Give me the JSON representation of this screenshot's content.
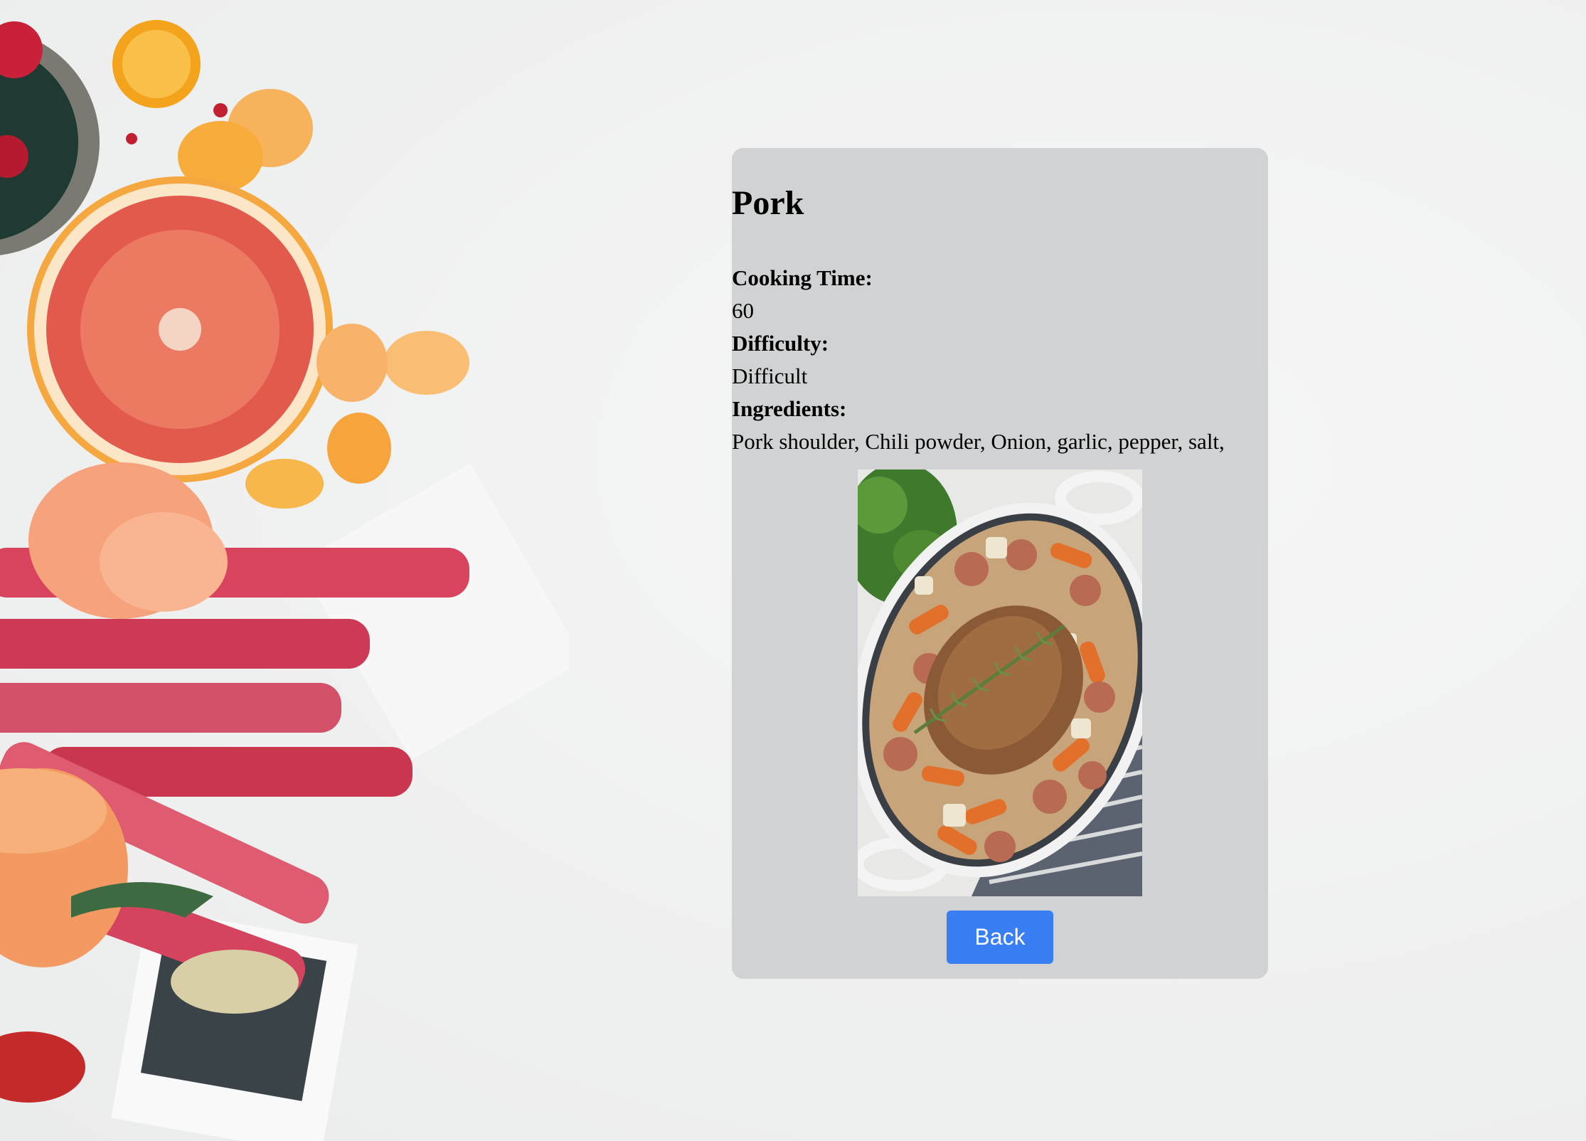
{
  "recipe": {
    "title": "Pork",
    "cooking_time_label": "Cooking Time:",
    "cooking_time_value": "60",
    "difficulty_label": "Difficulty:",
    "difficulty_value": "Difficult",
    "ingredients_label": "Ingredients:",
    "ingredients_value": "Pork shoulder, Chili powder, Onion, garlic, pepper, salt,",
    "image_subject": "roast-pork-with-vegetables-photo"
  },
  "actions": {
    "back_label": "Back"
  },
  "theme": {
    "card_bg": "#d1d2d3",
    "button_bg": "#3a7ef4",
    "page_bg": "#f1f2f2"
  }
}
